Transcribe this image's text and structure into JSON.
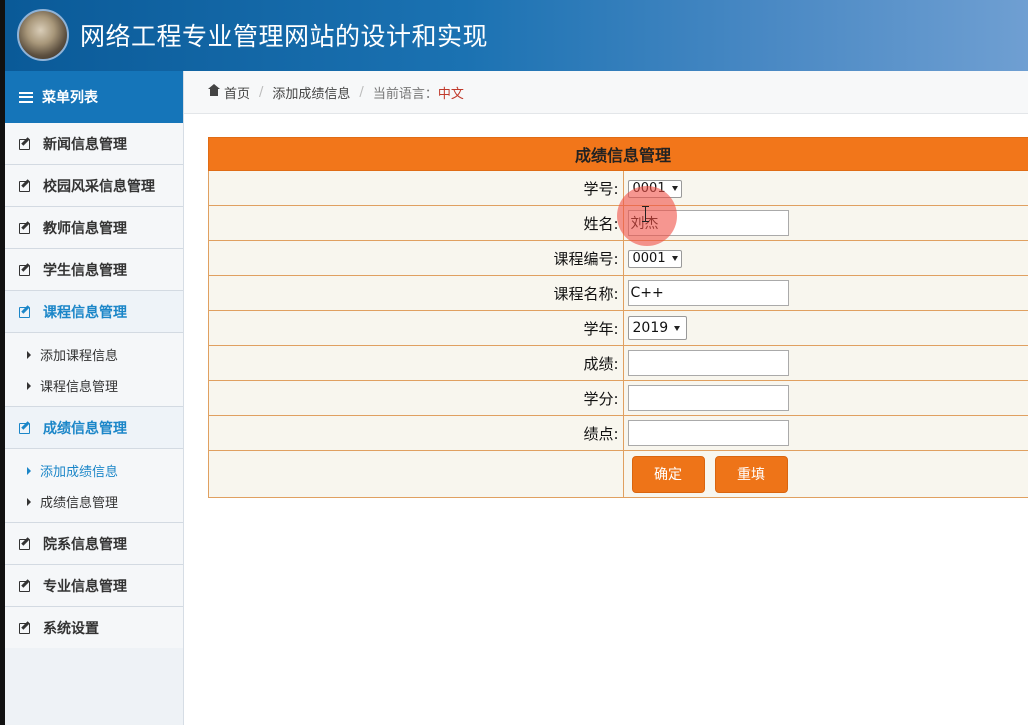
{
  "header": {
    "title": "网络工程专业管理网站的设计和实现"
  },
  "sidebar": {
    "title": "菜单列表",
    "items": [
      {
        "label": "新闻信息管理"
      },
      {
        "label": "校园风采信息管理"
      },
      {
        "label": "教师信息管理"
      },
      {
        "label": "学生信息管理"
      },
      {
        "label": "课程信息管理",
        "subitems": [
          {
            "label": "添加课程信息"
          },
          {
            "label": "课程信息管理"
          }
        ]
      },
      {
        "label": "成绩信息管理",
        "subitems": [
          {
            "label": "添加成绩信息"
          },
          {
            "label": "成绩信息管理"
          }
        ]
      },
      {
        "label": "院系信息管理"
      },
      {
        "label": "专业信息管理"
      },
      {
        "label": "系统设置"
      }
    ]
  },
  "breadcrumb": {
    "home": "首页",
    "current": "添加成绩信息",
    "lang_label": "当前语言：",
    "lang_value": "中文"
  },
  "form": {
    "title": "成绩信息管理",
    "fields": {
      "student_no": {
        "label": "学号:",
        "value": "0001"
      },
      "name": {
        "label": "姓名:",
        "value": "刘杰"
      },
      "course_no": {
        "label": "课程编号:",
        "value": "0001"
      },
      "course_name": {
        "label": "课程名称:",
        "value": "C++"
      },
      "year": {
        "label": "学年:",
        "value": "2019"
      },
      "score": {
        "label": "成绩:",
        "value": ""
      },
      "credit": {
        "label": "学分:",
        "value": ""
      },
      "gpa": {
        "label": "绩点:",
        "value": ""
      }
    },
    "submit_label": "确定",
    "reset_label": "重填"
  },
  "colors": {
    "header_blue": "#0a5a98",
    "accent_orange": "#f2761a",
    "active_blue": "#1b86c8"
  }
}
